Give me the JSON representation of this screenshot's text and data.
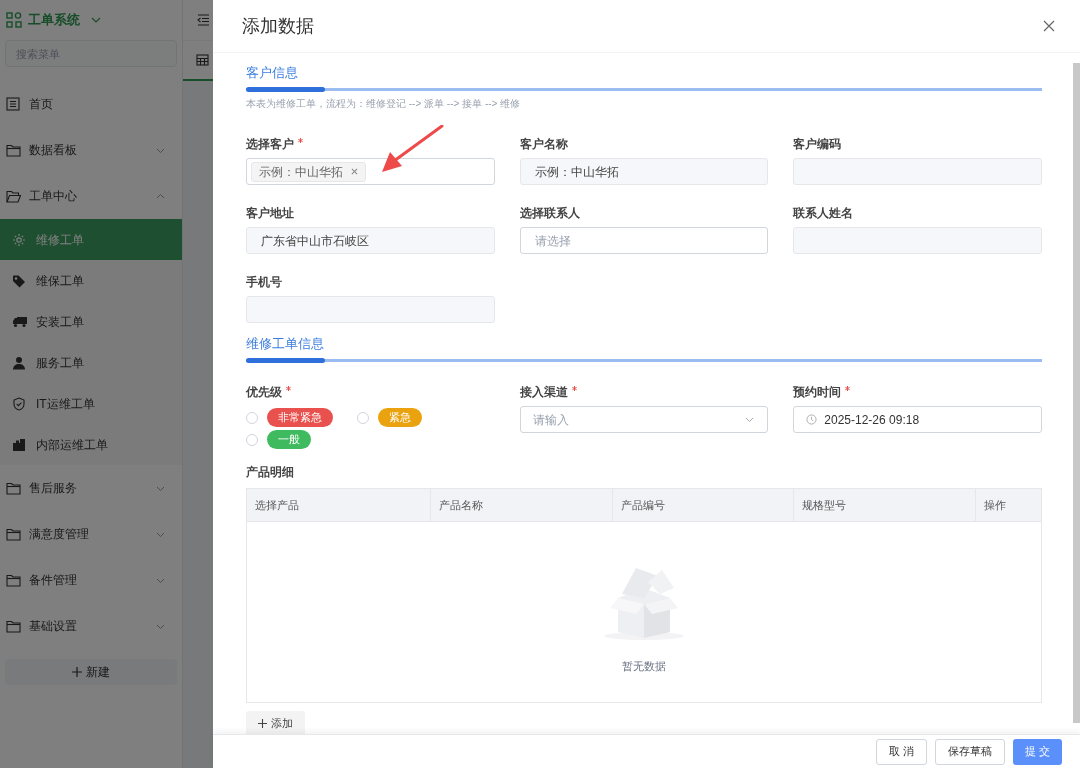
{
  "sidebar": {
    "brand": "工单系统",
    "search": {
      "placeholder": "搜索菜单"
    },
    "menu": [
      {
        "label": "首页",
        "selected": false
      },
      {
        "label": "数据看板",
        "selected": false,
        "expanded": false
      },
      {
        "label": "工单中心",
        "selected": false,
        "expanded": true,
        "children": [
          {
            "label": "维修工单",
            "selected": true
          },
          {
            "label": "维保工单",
            "selected": false
          },
          {
            "label": "安装工单",
            "selected": false
          },
          {
            "label": "服务工单",
            "selected": false
          },
          {
            "label": "IT运维工单",
            "selected": false
          },
          {
            "label": "内部运维工单",
            "selected": false
          }
        ]
      },
      {
        "label": "售后服务",
        "selected": false,
        "expanded": false
      },
      {
        "label": "满意度管理",
        "selected": false,
        "expanded": false
      },
      {
        "label": "备件管理",
        "selected": false,
        "expanded": false
      },
      {
        "label": "基础设置",
        "selected": false,
        "expanded": false
      }
    ],
    "new_button": "新建"
  },
  "drawer": {
    "title": "添加数据",
    "sections": [
      {
        "title": "客户信息",
        "note": "本表为维修工单，流程为：维修登记 --> 派单 --> 接单 --> 维修",
        "fields": [
          {
            "label": "选择客户",
            "required": true,
            "kind": "tags",
            "tags": [
              "示例：中山华拓"
            ]
          },
          {
            "label": "客户名称",
            "required": false,
            "kind": "readonly",
            "value": "示例：中山华拓"
          },
          {
            "label": "客户编码",
            "required": false,
            "kind": "readonly"
          },
          {
            "label": "客户地址",
            "required": false,
            "kind": "readonly",
            "value": "广东省中山市石岐区"
          },
          {
            "label": "选择联系人",
            "required": false,
            "kind": "input",
            "placeholder": "请选择"
          },
          {
            "label": "联系人姓名",
            "required": false,
            "kind": "readonly"
          },
          {
            "label": "手机号",
            "required": false,
            "kind": "readonly"
          }
        ]
      },
      {
        "title": "维修工单信息",
        "fields": [
          {
            "label": "优先级",
            "required": true,
            "kind": "radio",
            "options": [
              {
                "label": "非常紧急",
                "color": "#e8514d",
                "selected": false
              },
              {
                "label": "紧急",
                "color": "#eba20f",
                "selected": false
              },
              {
                "label": "一般",
                "color": "#3fba5f",
                "selected": false
              }
            ]
          },
          {
            "label": "接入渠道",
            "required": true,
            "kind": "select",
            "placeholder": "请输入"
          },
          {
            "label": "预约时间",
            "required": true,
            "kind": "datetime",
            "value": "2025-12-26 09:18"
          }
        ]
      }
    ],
    "products": {
      "label": "产品明细",
      "columns": [
        "选择产品",
        "产品名称",
        "产品编号",
        "规格型号",
        "操作"
      ],
      "empty_text": "暂无数据",
      "add_button": "添加"
    },
    "buttons": [
      {
        "label": "取 消",
        "primary": false
      },
      {
        "label": "保存草稿",
        "primary": false
      },
      {
        "label": "提 交",
        "primary": true
      }
    ]
  }
}
